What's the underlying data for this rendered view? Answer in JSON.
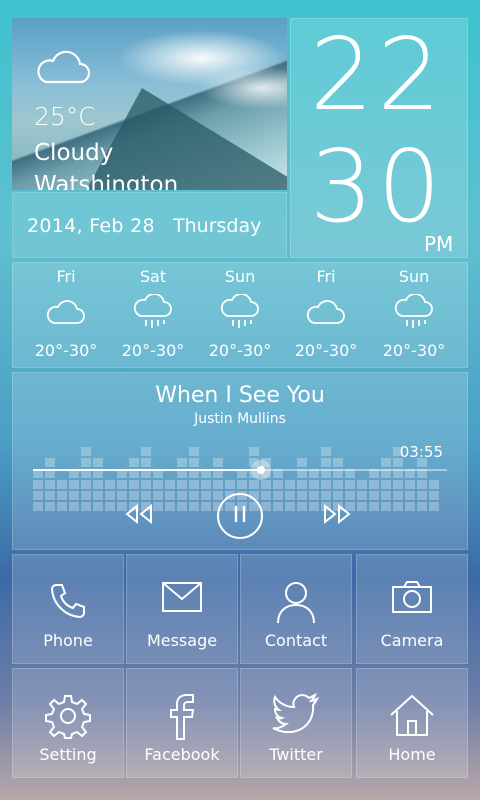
{
  "weather": {
    "temperature": "25°C",
    "condition": "Cloudy",
    "city": "Watshington",
    "date": "2014, Feb 28",
    "weekday": "Thursday"
  },
  "clock": {
    "hour": "22",
    "minute": "30",
    "ampm": "PM"
  },
  "forecast": [
    {
      "day": "Fri",
      "icon": "cloudy-icon",
      "temp": "20°-30°"
    },
    {
      "day": "Sat",
      "icon": "rain-icon",
      "temp": "20°-30°"
    },
    {
      "day": "Sun",
      "icon": "rain-icon",
      "temp": "20°-30°"
    },
    {
      "day": "Fri",
      "icon": "cloudy-icon",
      "temp": "20°-30°"
    },
    {
      "day": "Sun",
      "icon": "rain-icon",
      "temp": "20°-30°"
    }
  ],
  "music": {
    "title": "When I See You",
    "artist": "Justin Mullins",
    "time": "03:55",
    "progress": 0.55
  },
  "apps": [
    {
      "label": "Phone",
      "icon": "phone-icon"
    },
    {
      "label": "Message",
      "icon": "envelope-icon"
    },
    {
      "label": "Contact",
      "icon": "person-icon"
    },
    {
      "label": "Camera",
      "icon": "camera-icon"
    },
    {
      "label": "Setting",
      "icon": "gear-icon"
    },
    {
      "label": "Facebook",
      "icon": "facebook-icon"
    },
    {
      "label": "Twitter",
      "icon": "twitter-icon"
    },
    {
      "label": "Home",
      "icon": "home-icon"
    }
  ]
}
